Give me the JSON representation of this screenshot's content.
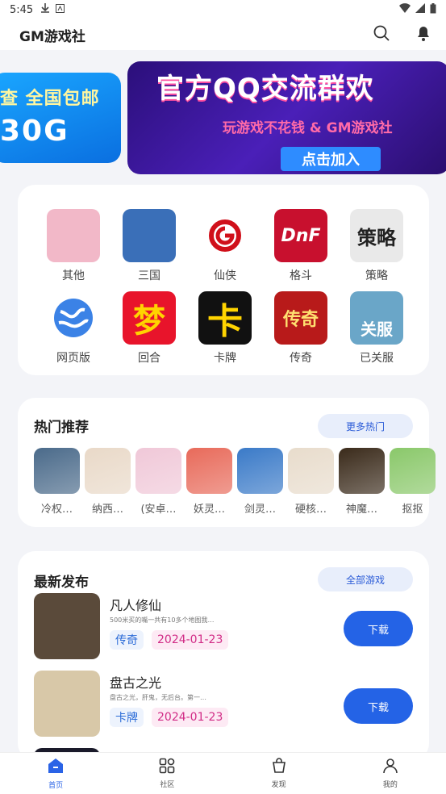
{
  "status_bar": {
    "time": "5:45"
  },
  "header": {
    "title": "GM游戏社"
  },
  "banner": {
    "left_line1": "查 全国包邮",
    "left_line2": "30G",
    "right_title": "官方QQ交流群欢",
    "right_subtitle": "玩游戏不花钱 & GM游戏社",
    "right_button": "点击加入"
  },
  "categories": [
    {
      "label": "其他",
      "glyph": "",
      "color": "#f2b8c8"
    },
    {
      "label": "三国",
      "glyph": "",
      "color": "#3a6fb8"
    },
    {
      "label": "仙侠",
      "glyph": "仙侠游戏",
      "color": "#ffffff"
    },
    {
      "label": "格斗",
      "glyph": "DnF",
      "color": "#c8102e"
    },
    {
      "label": "策略",
      "glyph": "策略",
      "color": "#e9e9e9"
    },
    {
      "label": "网页版",
      "glyph": "",
      "color": "#3b82e6"
    },
    {
      "label": "回合",
      "glyph": "梦",
      "color": "#e8142b"
    },
    {
      "label": "卡牌",
      "glyph": "卡",
      "color": "#111111"
    },
    {
      "label": "传奇",
      "glyph": "传奇",
      "color": "#b81a1a"
    },
    {
      "label": "已关服",
      "glyph": "关服",
      "color": "#6aa6c8"
    }
  ],
  "hot": {
    "title": "热门推荐",
    "more_label": "更多热门",
    "items": [
      {
        "label": "冷权…",
        "color": "#4a6a8a"
      },
      {
        "label": "纳西…",
        "color": "#e9d9c8"
      },
      {
        "label": "(安卓…",
        "color": "#f0c8d8"
      },
      {
        "label": "妖灵…",
        "color": "#e86a5a"
      },
      {
        "label": "剑灵…",
        "color": "#3a7ac8"
      },
      {
        "label": "硬核…",
        "color": "#e8dccc"
      },
      {
        "label": "神魔…",
        "color": "#3a2a1a"
      },
      {
        "label": "抠抠",
        "color": "#8ac86a"
      }
    ]
  },
  "latest": {
    "title": "最新发布",
    "all_label": "全部游戏",
    "games": [
      {
        "name": "凡人修仙",
        "desc": "500米买的嘴一共有10多个地图我…",
        "type": "传奇",
        "date": "2024-01-23",
        "download": "下载",
        "color": "#5a4a3a"
      },
      {
        "name": "盘古之光",
        "desc": "盘古之光，肝鬼，无后台。第一…",
        "type": "卡牌",
        "date": "2024-01-23",
        "download": "下载",
        "color": "#d8c8a8"
      },
      {
        "name": "",
        "desc": "",
        "type": "",
        "date": "",
        "download": "",
        "color": "#1a1a2a"
      }
    ]
  },
  "nav": [
    {
      "label": "首页",
      "active": true
    },
    {
      "label": "社区",
      "active": false
    },
    {
      "label": "发现",
      "active": false
    },
    {
      "label": "我的",
      "active": false
    }
  ]
}
